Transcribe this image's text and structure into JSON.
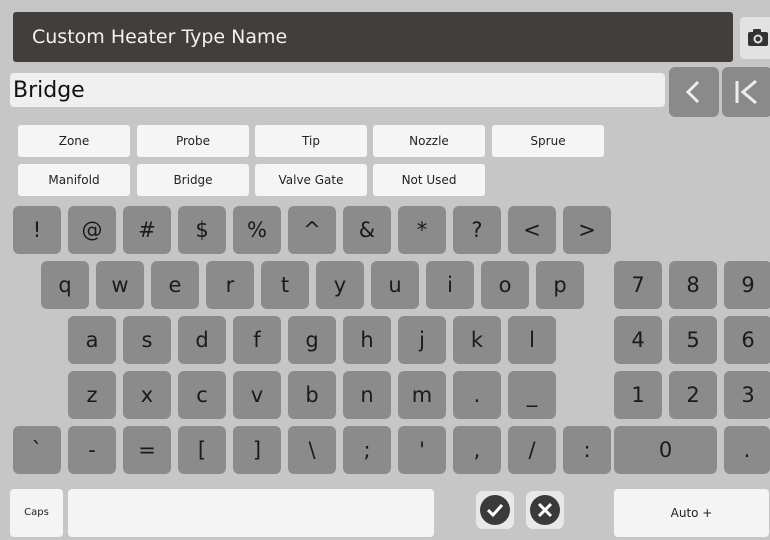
{
  "title": "Custom Heater Type Name",
  "input": {
    "value": "Bridge"
  },
  "icons": {
    "camera": "camera-icon",
    "back": "chevron-left-icon",
    "first": "first-page-icon",
    "confirm": "check-circle-icon",
    "cancel": "x-circle-icon"
  },
  "presets": [
    "Zone",
    "Probe",
    "Tip",
    "Nozzle",
    "Sprue",
    "Manifold",
    "Bridge",
    "Valve Gate",
    "Not Used"
  ],
  "symbols_row": [
    "!",
    "@",
    "#",
    "$",
    "%",
    "^",
    "&",
    "*",
    "?",
    "<",
    ">"
  ],
  "row_q": [
    "q",
    "w",
    "e",
    "r",
    "t",
    "y",
    "u",
    "i",
    "o",
    "p"
  ],
  "row_a": [
    "a",
    "s",
    "d",
    "f",
    "g",
    "h",
    "j",
    "k",
    "l"
  ],
  "row_z": [
    "z",
    "x",
    "c",
    "v",
    "b",
    "n",
    "m",
    ".",
    "_"
  ],
  "row_punct": [
    "`",
    "-",
    "=",
    "[",
    "]",
    "\\",
    ";",
    "'",
    ",",
    "/",
    ":"
  ],
  "numpad": [
    "7",
    "8",
    "9",
    "4",
    "5",
    "6",
    "1",
    "2",
    "3",
    "0",
    "."
  ],
  "bottom": {
    "caps": "Caps",
    "auto": "Auto +"
  },
  "colors": {
    "background": "#c6c6c6",
    "key": "#8b8b8b",
    "title_bar": "#423e3b"
  }
}
